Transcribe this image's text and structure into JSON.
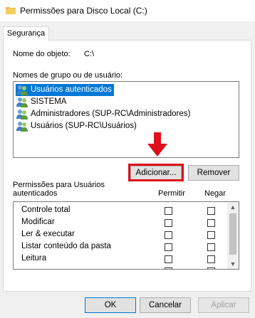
{
  "window": {
    "title": "Permissões para Disco Local (C:)",
    "icon": "folder-icon"
  },
  "tabs": [
    {
      "label": "Segurança",
      "active": true
    }
  ],
  "object": {
    "label": "Nome do objeto:",
    "value": "C:\\"
  },
  "groups": {
    "label": "Nomes de grupo ou de usuário:",
    "items": [
      {
        "name": "Usuários autenticados",
        "selected": true,
        "icon": "users-icon"
      },
      {
        "name": "SISTEMA",
        "selected": false,
        "icon": "users-icon"
      },
      {
        "name": "Administradores (SUP-RC\\Administradores)",
        "selected": false,
        "icon": "users-icon"
      },
      {
        "name": "Usuários (SUP-RC\\Usuários)",
        "selected": false,
        "icon": "users-icon"
      }
    ]
  },
  "group_buttons": {
    "add": "Adicionar...",
    "remove": "Remover"
  },
  "permissions": {
    "label_line1": "Permissões para Usuários",
    "label_line2": "autenticados",
    "allow_header": "Permitir",
    "deny_header": "Negar",
    "rows": [
      {
        "name": "Controle total",
        "allow": false,
        "deny": false
      },
      {
        "name": "Modificar",
        "allow": false,
        "deny": false
      },
      {
        "name": "Ler & executar",
        "allow": false,
        "deny": false
      },
      {
        "name": "Listar conteúdo da pasta",
        "allow": false,
        "deny": false
      },
      {
        "name": "Leitura",
        "allow": false,
        "deny": false
      }
    ]
  },
  "footer": {
    "ok": "OK",
    "cancel": "Cancelar",
    "apply": "Aplicar"
  },
  "colors": {
    "selection": "#0078d7",
    "highlight": "#e0101a"
  }
}
